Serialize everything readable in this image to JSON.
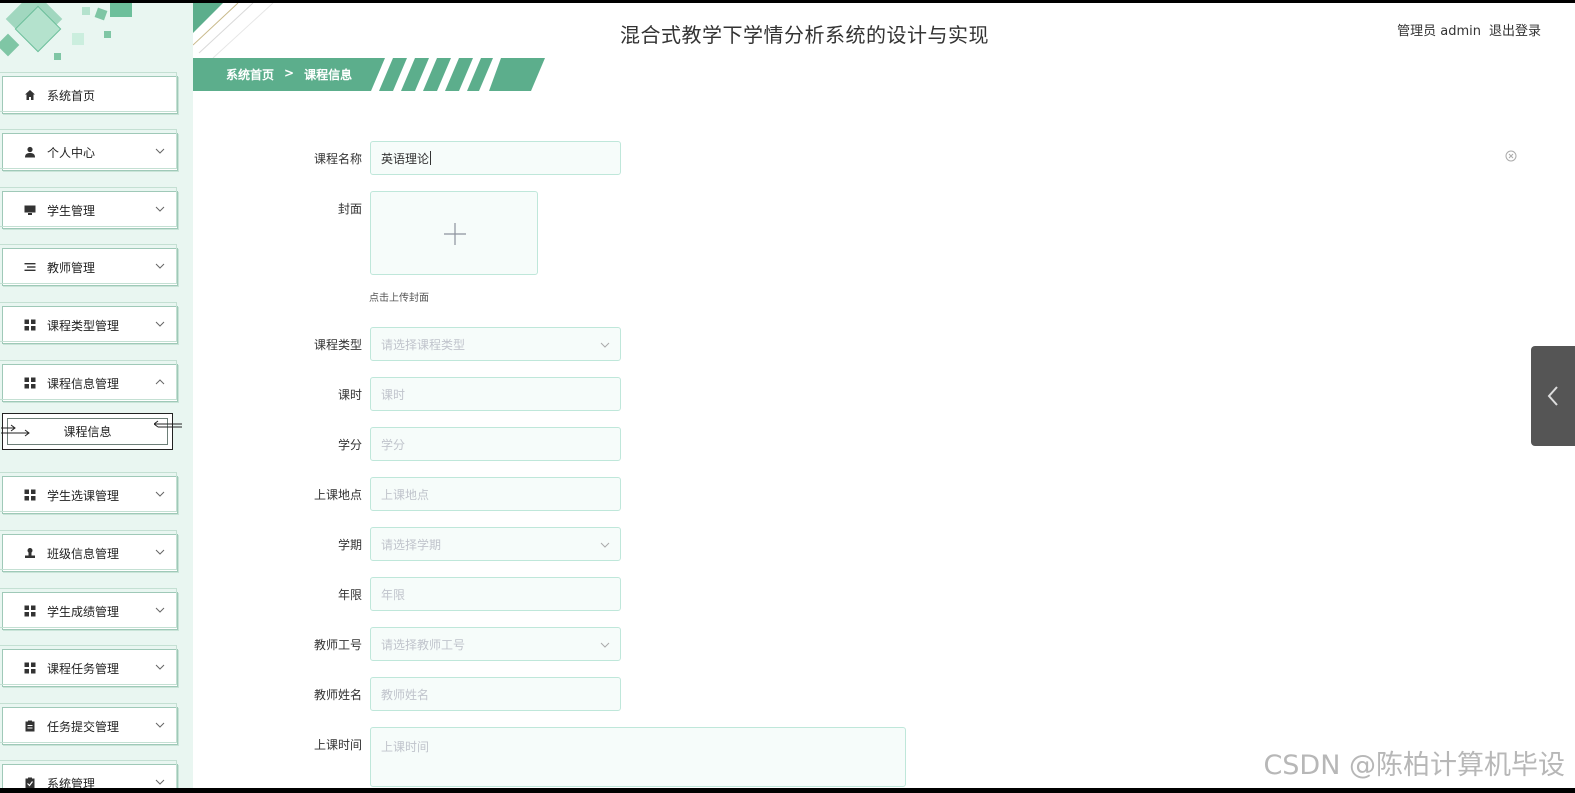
{
  "app": {
    "title": "混合式教学下学情分析系统的设计与实现",
    "user_label": "管理员 admin",
    "logout": "退出登录"
  },
  "breadcrumb": {
    "home": "系统首页",
    "separator": ">",
    "current": "课程信息"
  },
  "sidebar": {
    "items": [
      {
        "label": "系统首页",
        "icon": "home-icon"
      },
      {
        "label": "个人中心",
        "icon": "user-icon"
      },
      {
        "label": "学生管理",
        "icon": "monitor-icon"
      },
      {
        "label": "教师管理",
        "icon": "list-icon"
      },
      {
        "label": "课程类型管理",
        "icon": "grid-icon"
      },
      {
        "label": "课程信息管理",
        "icon": "grid-icon"
      },
      {
        "label": "学生选课管理",
        "icon": "grid-icon"
      },
      {
        "label": "班级信息管理",
        "icon": "stamp-icon"
      },
      {
        "label": "学生成绩管理",
        "icon": "grid-icon"
      },
      {
        "label": "课程任务管理",
        "icon": "grid-icon"
      },
      {
        "label": "任务提交管理",
        "icon": "clipboard-icon"
      },
      {
        "label": "系统管理",
        "icon": "clipboard-check-icon"
      }
    ],
    "sub_item": "课程信息"
  },
  "form": {
    "course_name": {
      "label": "课程名称",
      "value": "英语理论"
    },
    "cover": {
      "label": "封面",
      "hint": "点击上传封面"
    },
    "course_type": {
      "label": "课程类型",
      "placeholder": "请选择课程类型"
    },
    "hours": {
      "label": "课时",
      "placeholder": "课时"
    },
    "credits": {
      "label": "学分",
      "placeholder": "学分"
    },
    "location": {
      "label": "上课地点",
      "placeholder": "上课地点"
    },
    "term": {
      "label": "学期",
      "placeholder": "请选择学期"
    },
    "years": {
      "label": "年限",
      "placeholder": "年限"
    },
    "teacher_id": {
      "label": "教师工号",
      "placeholder": "请选择教师工号"
    },
    "teacher_name": {
      "label": "教师姓名",
      "placeholder": "教师姓名"
    },
    "class_time": {
      "label": "上课时间",
      "placeholder": "上课时间"
    }
  },
  "watermark": "CSDN @陈柏计算机毕设",
  "colors": {
    "accent": "#5cae8c",
    "sidebar_bg": "#e9f6f1",
    "field_border": "#bfe7da"
  }
}
